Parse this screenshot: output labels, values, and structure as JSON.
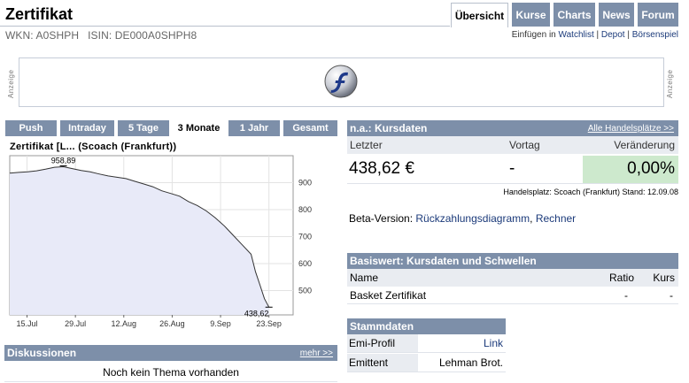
{
  "header": {
    "title": "Zertifikat",
    "wkn": "WKN: A0SHPH",
    "isin": "ISIN: DE000A0SHPH8",
    "tabs": [
      "Übersicht",
      "Kurse",
      "Charts",
      "News",
      "Forum"
    ],
    "links_prefix": "Einfügen in",
    "links": [
      "Watchlist",
      "Depot",
      "Börsenspiel"
    ]
  },
  "ad": {
    "label": "Anzeige",
    "icon": "flash-icon"
  },
  "periods": [
    "Push",
    "Intraday",
    "5 Tage",
    "3 Monate",
    "1 Jahr",
    "Gesamt"
  ],
  "chart": {
    "title": "Zertifikat   [L... (Scoach (Frankfurt))"
  },
  "chart_data": {
    "type": "area",
    "title": "Zertifikat   [L... (Scoach (Frankfurt))",
    "x_ticks": [
      "15.Jul",
      "29.Jul",
      "12.Aug",
      "26.Aug",
      "9.Sep",
      "23.Sep"
    ],
    "y_ticks": [
      500,
      600,
      700,
      800,
      900
    ],
    "ylim": [
      410,
      1000
    ],
    "annotations": {
      "max": "958,89",
      "last": "438,62"
    },
    "series": [
      {
        "x": [
          0,
          2,
          4,
          6,
          8,
          10,
          12,
          14,
          16,
          18,
          20,
          22,
          24,
          26,
          28,
          30,
          32,
          34,
          36,
          38,
          40,
          42,
          44,
          46,
          48,
          50,
          52,
          54,
          55,
          56,
          57,
          58
        ],
        "values": [
          935,
          938,
          940,
          944,
          950,
          957,
          958.89,
          952,
          945,
          940,
          932,
          925,
          920,
          915,
          905,
          895,
          885,
          870,
          860,
          850,
          830,
          815,
          795,
          770,
          740,
          705,
          670,
          635,
          570,
          520,
          470,
          438.62
        ]
      }
    ],
    "grid": true,
    "fill_color": "#e8eaf8",
    "line_color": "#333333"
  },
  "discussions": {
    "title": "Diskussionen",
    "more": "mehr >>",
    "empty": "Noch kein Thema vorhanden"
  },
  "kurs": {
    "title": "n.a.: Kursdaten",
    "all_link": "Alle Handelsplätze >>",
    "col_last": "Letzter",
    "col_prev": "Vortag",
    "col_change": "Veränderung",
    "last": "438,62 €",
    "prev": "-",
    "change": "0,00%",
    "meta": "Handelsplatz: Scoach (Frankfurt)   Stand: 12.09.08",
    "change_color": "#cde9cd"
  },
  "beta": {
    "prefix": "Beta-Version:",
    "link1": "Rückzahlungsdiagramm",
    "sep": ",",
    "link2": "Rechner"
  },
  "basis": {
    "title": "Basiswert: Kursdaten und Schwellen",
    "col_name": "Name",
    "col_ratio": "Ratio",
    "col_kurs": "Kurs",
    "row_name": "Basket Zertifikat",
    "row_ratio": "-",
    "row_kurs": "-"
  },
  "stamm": {
    "title": "Stammdaten",
    "rows": [
      {
        "key": "Emi-Profil",
        "value": "Link"
      },
      {
        "key": "Emittent",
        "value": "Lehman Brot."
      }
    ]
  },
  "colors": {
    "accent": "#7d8fa9",
    "link": "#1b3a7a",
    "header_bg": "#e9ecf1"
  }
}
